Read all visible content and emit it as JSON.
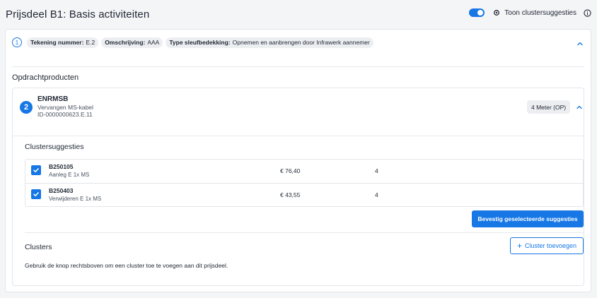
{
  "page": {
    "title": "Prijsdeel B1: Basis activiteiten",
    "toggle_on": true,
    "cluster_suggestions_label": "Toon clustersuggesties"
  },
  "info": {
    "step": "1",
    "pills": [
      {
        "label": "Tekening nummer:",
        "value": "E.2"
      },
      {
        "label": "Omschrijving:",
        "value": "AAA"
      },
      {
        "label": "Type sleufbedekking:",
        "value": "Opnemen en aanbrengen door Infrawerk aannemer"
      }
    ]
  },
  "products_section": {
    "label": "Opdrachtproducten"
  },
  "product": {
    "step": "2",
    "code": "ENRMSB",
    "description": "Vervangen MS-kabel",
    "id": "ID-0000000623.E.11",
    "quantity": "4 Meter (OP)"
  },
  "suggestions": {
    "label": "Clustersuggesties",
    "rows": [
      {
        "code": "B250105",
        "description": "Aanleg E 1x MS",
        "price": "€ 76,40",
        "count": "4",
        "checked": true
      },
      {
        "code": "B250403",
        "description": "Verwijderen E 1x MS",
        "price": "€ 43,55",
        "count": "4",
        "checked": true
      }
    ],
    "confirm_label": "Bevestig geselecteerde suggesties"
  },
  "clusters": {
    "label": "Clusters",
    "add_label": "Cluster toevoegen",
    "help": "Gebruik de knop rechtsboven om een cluster toe te voegen aan dit prijsdeel."
  },
  "colors": {
    "accent": "#1677e5",
    "background": "#f4f5f7"
  }
}
